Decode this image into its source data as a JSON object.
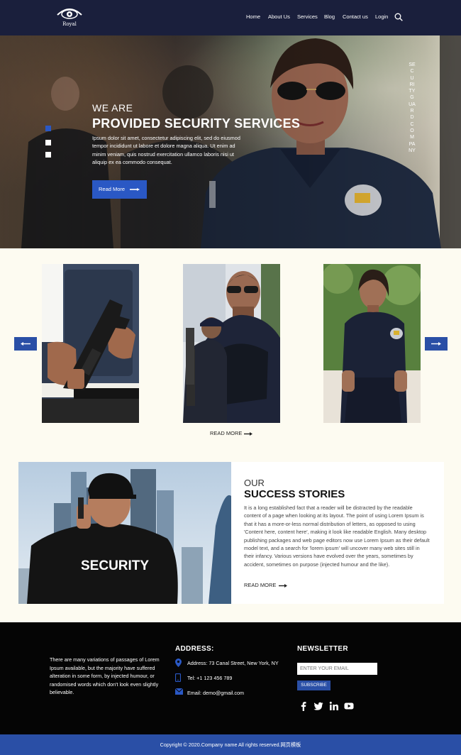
{
  "nav": {
    "logo_text": "Royal",
    "items": [
      {
        "label": "Home"
      },
      {
        "label": "About Us"
      },
      {
        "label": "Services"
      },
      {
        "label": "Blog"
      },
      {
        "label": "Contact us"
      },
      {
        "label": "Login"
      }
    ]
  },
  "hero": {
    "eyebrow": "WE ARE",
    "title": "PROVIDED SECURITY SERVICES",
    "text": "Ipsum dolor sit amet, consectetur adipiscing elit, sed do eiusmod tempor incididunt ut labore et dolore magna aliqua. Ut enim ad minim veniam, quis nostrud exercitation ullamco laboris nisi ut aliquip ex ea commodo consequat.",
    "button_label": "Read More",
    "vertical_text": "SECURITYGUARDCOMPANY",
    "slide_dots": 3,
    "active_slide": 1
  },
  "gallery": {
    "read_more": "READ MORE"
  },
  "stories": {
    "eyebrow": "OUR",
    "title": "SUCCESS STORIES",
    "text": "It is a long established fact that a reader will be distracted by the readable content of a page when looking at its layout. The point of using Lorem Ipsum is that it has a more-or-less normal distribution of letters, as opposed to using 'Content here, content here', making it look like readable English. Many desktop publishing packages and web page editors now use Lorem Ipsum as their default model text, and a search for 'lorem ipsum' will uncover many web sites still in their infancy. Various versions have evolved over the years, sometimes by accident, sometimes on purpose (injected humour and the like).",
    "read_more": "READ MORE",
    "image_caption": "SECURITY"
  },
  "footer": {
    "about": "There are many variations of passages of Lorem Ipsum available, but the majority have suffered alteration in some form, by injected humour, or randomised words which don't look even slightly believable.",
    "address_heading": "ADDRESS:",
    "address": "Address: 73 Canal Street, New York, NY",
    "phone": "Tel: +1 123 456 789",
    "email": "Email: demo@gmail.com",
    "newsletter_heading": "NEWSLETTER",
    "email_placeholder": "ENTER YOUR EMAIL",
    "subscribe_label": "SUBSCRIBE",
    "social": [
      "facebook-icon",
      "twitter-icon",
      "linkedin-icon",
      "youtube-icon"
    ],
    "copyright": "Copyright © 2020.Company name All rights reserved.网页模板"
  },
  "colors": {
    "nav_bg": "#1a1f3c",
    "accent": "#2a4fa6",
    "page_bg": "#fdfbf1",
    "footer_bg": "#050505"
  }
}
